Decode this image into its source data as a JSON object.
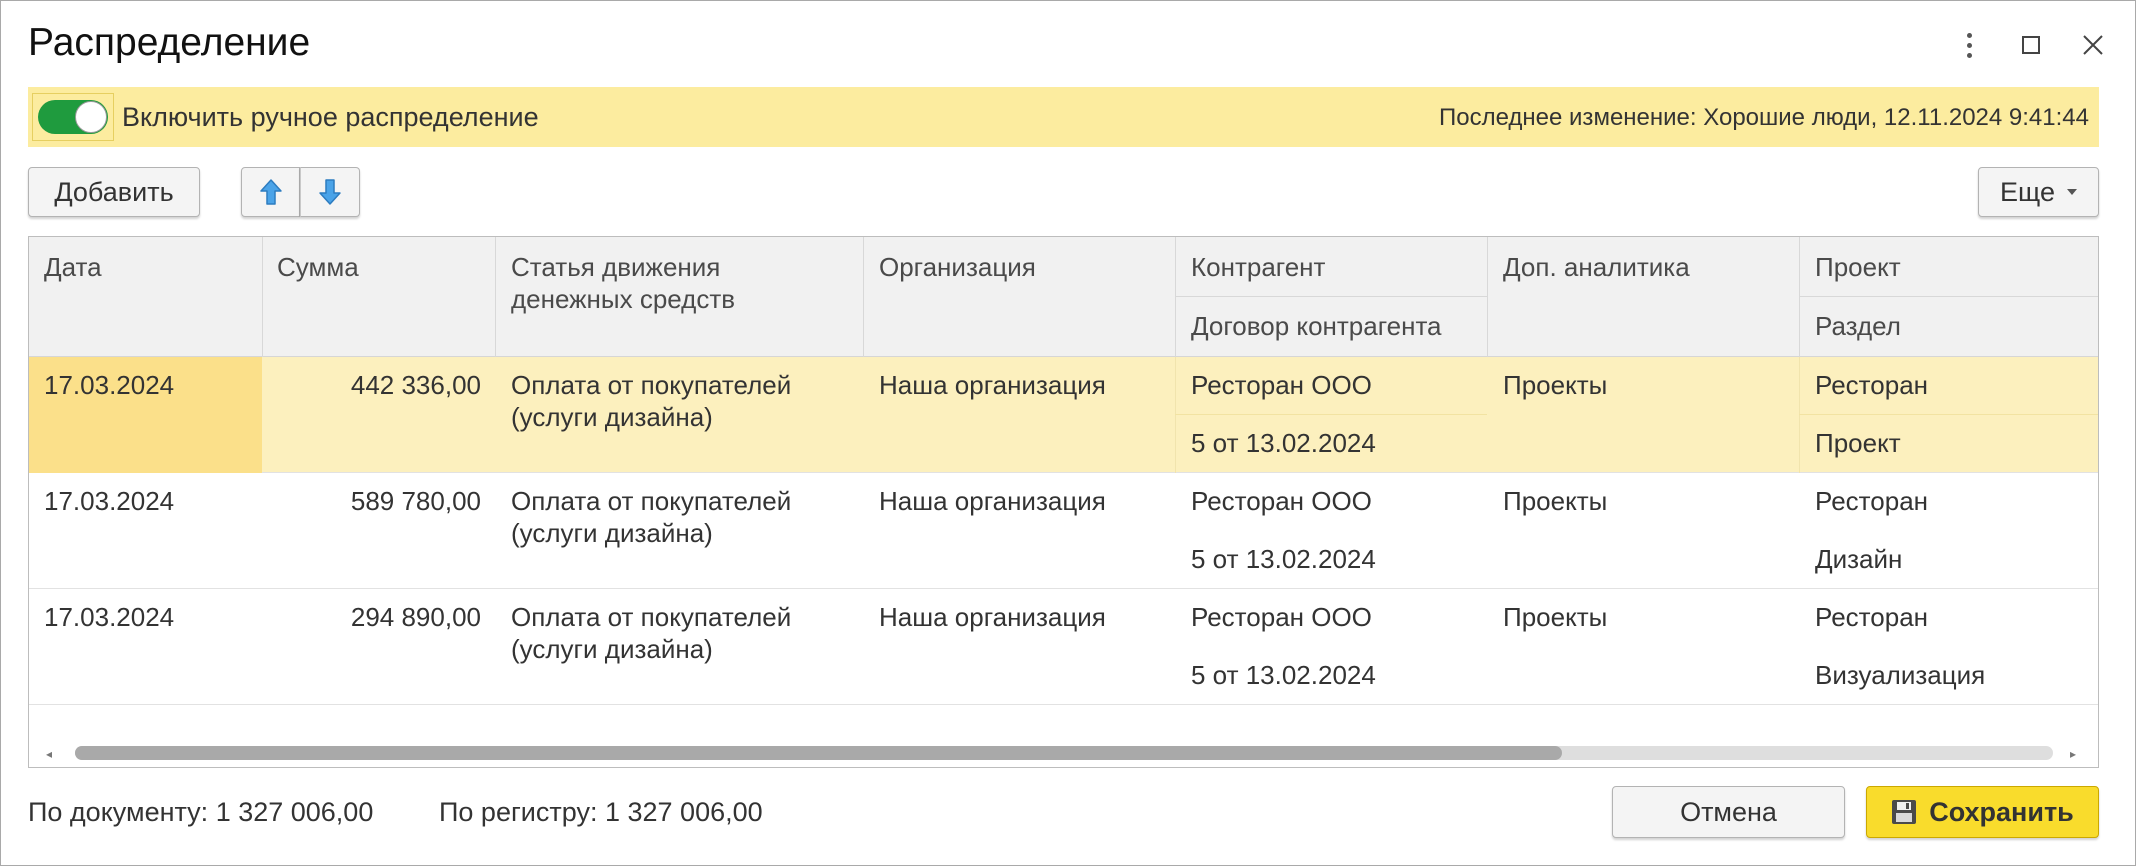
{
  "window": {
    "title": "Распределение"
  },
  "banner": {
    "toggle_on": true,
    "toggle_label": "Включить ручное распределение",
    "last_change": "Последнее изменение: Хорошие люди, 12.11.2024 9:41:44",
    "bg_color": "#fcec9f"
  },
  "toolbar": {
    "add_label": "Добавить",
    "up_icon": "arrow-up-icon",
    "down_icon": "arrow-down-icon",
    "more_label": "Еще"
  },
  "table": {
    "headers": {
      "date": "Дата",
      "sum": "Сумма",
      "article_line1": "Статья движения",
      "article_line2": "денежных средств",
      "org": "Организация",
      "counterparty": "Контрагент",
      "contract": "Договор контрагента",
      "analytics": "Доп. аналитика",
      "project": "Проект",
      "section": "Раздел"
    },
    "rows": [
      {
        "date": "17.03.2024",
        "sum": "442 336,00",
        "article_line1": "Оплата от покупателей",
        "article_line2": "(услуги дизайна)",
        "org": "Наша организация",
        "counterparty": "Ресторан ООО",
        "contract": "5 от 13.02.2024",
        "analytics": "Проекты",
        "project": "Ресторан",
        "section": "Проект"
      },
      {
        "date": "17.03.2024",
        "sum": "589 780,00",
        "article_line1": "Оплата от покупателей",
        "article_line2": "(услуги дизайна)",
        "org": "Наша организация",
        "counterparty": "Ресторан ООО",
        "contract": "5 от 13.02.2024",
        "analytics": "Проекты",
        "project": "Ресторан",
        "section": "Дизайн"
      },
      {
        "date": "17.03.2024",
        "sum": "294 890,00",
        "article_line1": "Оплата от покупателей",
        "article_line2": "(услуги дизайна)",
        "org": "Наша организация",
        "counterparty": "Ресторан ООО",
        "contract": "5 от 13.02.2024",
        "analytics": "Проекты",
        "project": "Ресторан",
        "section": "Визуализация"
      }
    ],
    "selected_row": 0
  },
  "footer": {
    "doc_label": "По документу:",
    "doc_value": "1 327 006,00",
    "reg_label": "По регистру:",
    "reg_value": "1 327 006,00",
    "cancel_label": "Отмена",
    "save_label": "Сохранить",
    "save_icon": "floppy-disk-icon",
    "save_color": "#f9dc2c"
  }
}
